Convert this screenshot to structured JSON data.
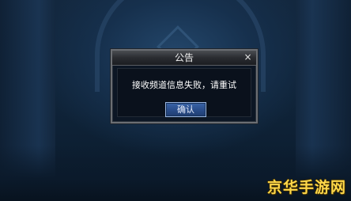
{
  "dialog": {
    "title": "公告",
    "close_icon": "×",
    "message": "接收频道信息失败，请重试",
    "confirm_label": "确认"
  },
  "watermark": {
    "text": "京华手游网"
  },
  "colors": {
    "dialog_border": "#6b6e73",
    "button_fill": "#2a4e8c",
    "watermark": "#ffd84a"
  }
}
